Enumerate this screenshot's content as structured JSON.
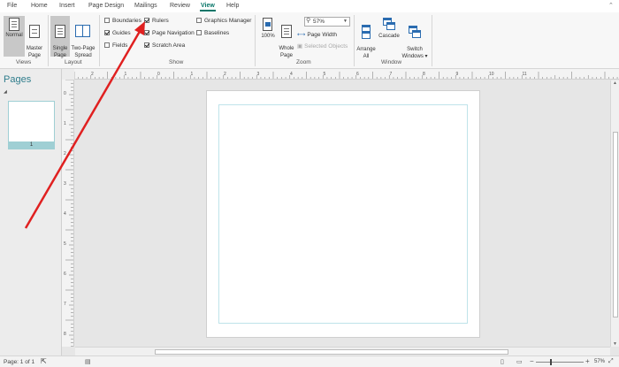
{
  "tabs": [
    "File",
    "Home",
    "Insert",
    "Page Design",
    "Mailings",
    "Review",
    "View",
    "Help"
  ],
  "active_tab": "View",
  "groups": {
    "views": {
      "label": "Views",
      "normal": "Normal",
      "master_page": "Master\nPage"
    },
    "layout": {
      "label": "Layout",
      "single_page": "Single\nPage",
      "two_page_spread": "Two-Page\nSpread"
    },
    "show": {
      "label": "Show",
      "boundaries": {
        "label": "Boundaries",
        "checked": false
      },
      "guides": {
        "label": "Guides",
        "checked": true
      },
      "fields": {
        "label": "Fields",
        "checked": false
      },
      "rulers": {
        "label": "Rulers",
        "checked": true
      },
      "page_navigation": {
        "label": "Page Navigation",
        "checked": true
      },
      "scratch_area": {
        "label": "Scratch Area",
        "checked": true
      },
      "graphics_manager": {
        "label": "Graphics Manager",
        "checked": false
      },
      "baselines": {
        "label": "Baselines",
        "checked": false
      }
    },
    "zoom": {
      "label": "Zoom",
      "hundred": "100%",
      "whole_page": "Whole\nPage",
      "zoom_value": "57%",
      "page_width": "Page Width",
      "selected_objects": "Selected Objects"
    },
    "window": {
      "label": "Window",
      "arrange_all": "Arrange\nAll",
      "cascade": "Cascade",
      "switch_windows": "Switch\nWindows ▾"
    }
  },
  "pages_pane": {
    "title": "Pages",
    "thumb_number": "1"
  },
  "status": {
    "page_info": "Page: 1 of 1",
    "zoom_percent": "57%"
  },
  "hruler_labels": [
    "2",
    "1",
    "0",
    "1",
    "2",
    "3",
    "4",
    "5",
    "6",
    "7",
    "8",
    "9",
    "10",
    "11"
  ],
  "vruler_labels": [
    "0",
    "1",
    "2",
    "3",
    "4",
    "5",
    "6",
    "7",
    "8"
  ],
  "accent_color": "#077568",
  "annotation_color": "#e02020"
}
